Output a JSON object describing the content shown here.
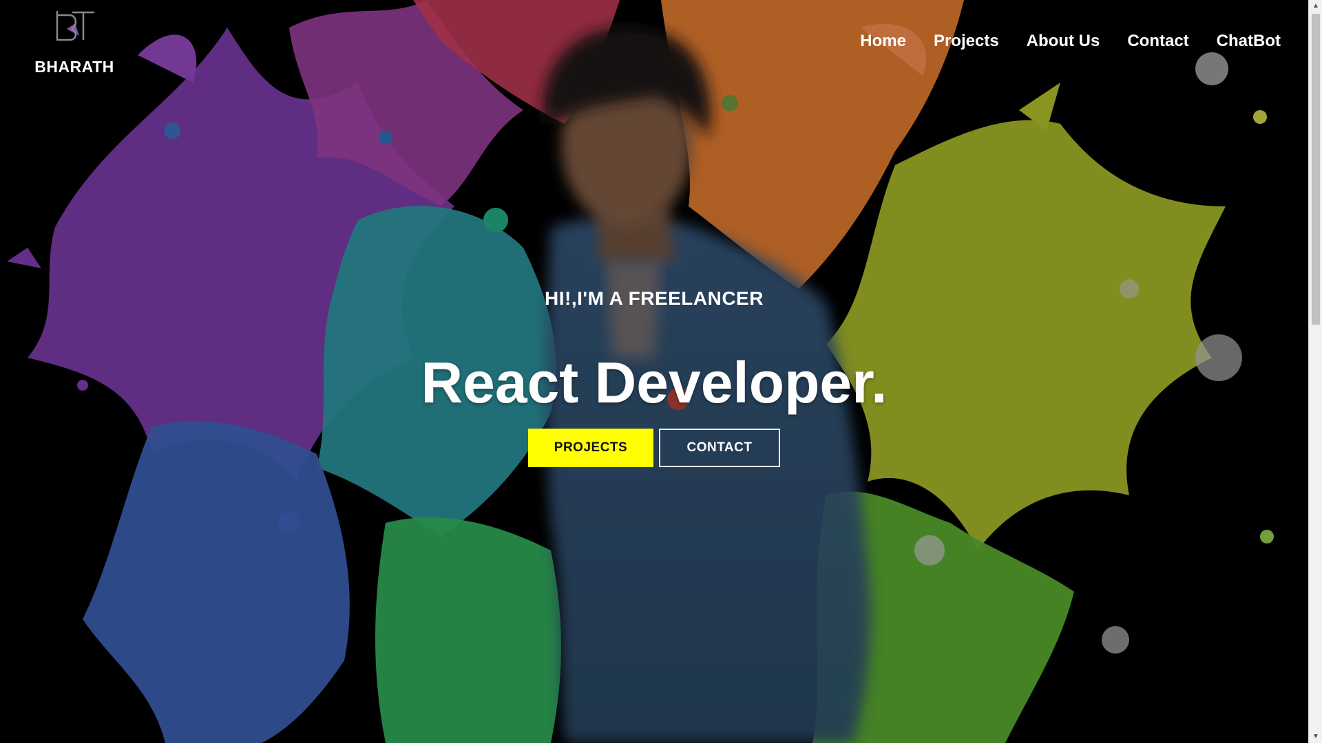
{
  "brand": {
    "name": "BHARATH",
    "logo": "BT-monogram-logo"
  },
  "nav": {
    "items": [
      {
        "label": "Home"
      },
      {
        "label": "Projects"
      },
      {
        "label": "About Us"
      },
      {
        "label": "Contact"
      },
      {
        "label": "ChatBot"
      }
    ]
  },
  "hero": {
    "kicker": "HI!,I'M A FREELANCER",
    "headline": "React Developer.",
    "primary_button": "PROJECTS",
    "secondary_button": "CONTACT"
  },
  "colors": {
    "accent": "#ffff00",
    "background": "#000000",
    "text": "#ffffff"
  }
}
